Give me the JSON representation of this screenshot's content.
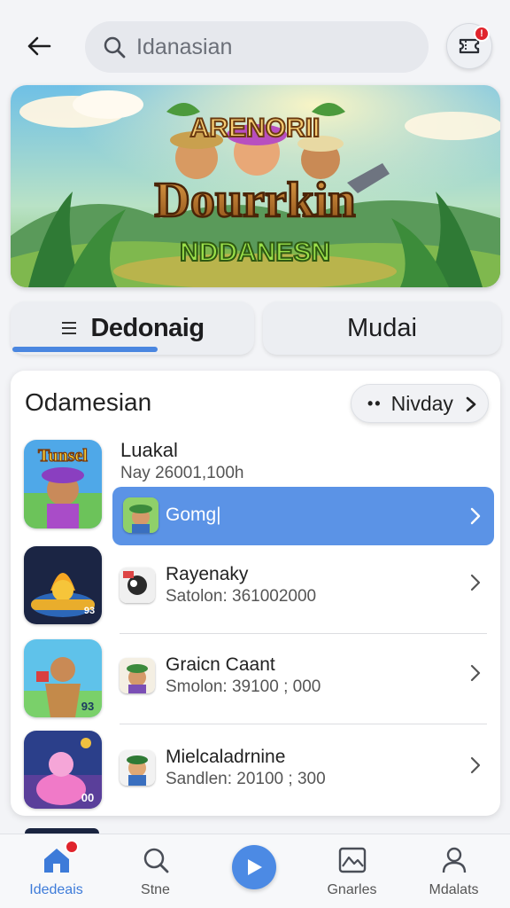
{
  "header": {
    "search_placeholder": "Idanasian",
    "cart_badge": "!"
  },
  "banner": {
    "line1": "ARENORII",
    "line2": "Dourrkin",
    "line3": "NDDANESN"
  },
  "tabs": [
    {
      "label": "Dedonaig",
      "active": true
    },
    {
      "label": "Mudai",
      "active": false
    }
  ],
  "section": {
    "title": "Odamesian",
    "sort_label": "Nivday"
  },
  "featured": {
    "thumb_text": "Tunsel",
    "title": "Luakal",
    "subtitle": "Nay 26001,100h",
    "action_label": "Gomg|"
  },
  "games": [
    {
      "thumb_text": "93",
      "title": "Rayenaky",
      "subtitle": "Satolon:  361002000"
    },
    {
      "thumb_text": "93",
      "title": "Graicn Caant",
      "subtitle": "Smolon:  39100 ; 000"
    },
    {
      "thumb_text": "00",
      "title": "Mielcaladrnine",
      "subtitle": "Sandlen:  20100 ; 300"
    }
  ],
  "bottom_nav": [
    {
      "label": "Idedeais",
      "icon": "home-icon",
      "active": true
    },
    {
      "label": "Stne",
      "icon": "search-icon",
      "active": false
    },
    {
      "label": "",
      "icon": "play-icon",
      "active": false
    },
    {
      "label": "Gnarles",
      "icon": "image-icon",
      "active": false
    },
    {
      "label": "Mdalats",
      "icon": "user-icon",
      "active": false
    }
  ],
  "colors": {
    "accent": "#4c8ae4",
    "highlight_row": "#5b93e6",
    "badge": "#e0242c",
    "background": "#f3f4f7"
  }
}
